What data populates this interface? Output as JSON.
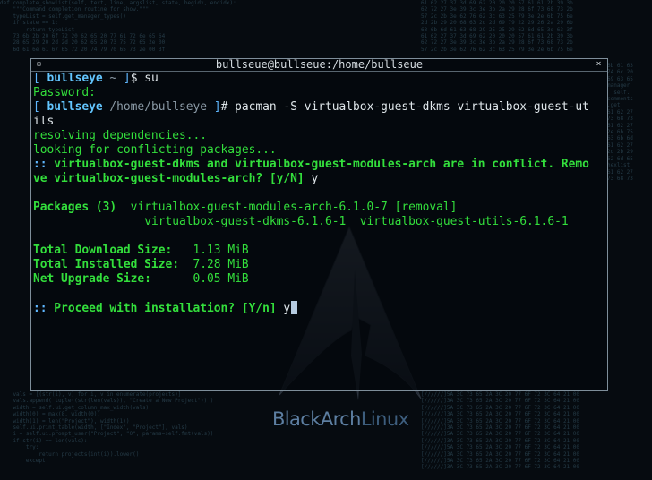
{
  "window": {
    "title": "bullseue@bullseue:/home/bullseue",
    "close_icon": "×"
  },
  "colors": {
    "terminal_green": "#33df3c",
    "prompt_bracket": "#5fb7ff",
    "prompt_user": "#63c6ff",
    "background": "#060b10"
  },
  "terminal": {
    "line1": {
      "open": "[",
      "user": "bullseye",
      "path": "~",
      "close": "]",
      "sym": "$",
      "cmd": "su"
    },
    "line2": "Password:",
    "line3": {
      "open": "[",
      "user": "bullseye",
      "path": "/home/bullseye",
      "close": "]",
      "sym": "#",
      "cmd": "pacman -S virtualbox-guest-dkms virtualbox-guest-ut"
    },
    "line4": "ils",
    "line5": "resolving dependencies...",
    "line6": "looking for conflicting packages...",
    "line7": {
      "marker": "::",
      "text": "virtualbox-guest-dkms and virtualbox-guest-modules-arch are in conflict. Remo"
    },
    "line8": {
      "text": "ve virtualbox-guest-modules-arch? [y/N]",
      "answer": "y"
    },
    "packages": {
      "label": "Packages (3)",
      "row1": "virtualbox-guest-modules-arch-6.1.0-7 [removal]",
      "row2": "virtualbox-guest-dkms-6.1.6-1  virtualbox-guest-utils-6.1.6-1"
    },
    "sizes": [
      {
        "label": "Total Download Size:",
        "value": "1.13 MiB"
      },
      {
        "label": "Total Installed Size:",
        "value": "7.28 MiB"
      },
      {
        "label": "Net Upgrade Size:",
        "value": "0.05 MiB"
      }
    ],
    "proceed": {
      "marker": "::",
      "text": "Proceed with installation? [Y/n]",
      "answer": "y"
    }
  },
  "wallpaper": {
    "brand_part1": "BlackArch",
    "brand_part2": "Linux",
    "code_tl": "def complete_showlist(self, text, line, argslist, state, begidx, endidx):\n    \"\"\"Command completion routine for show.\"\"\"\n    typeList = self.get_manager_types()\n    if state == 1:\n        return typeList\n    73 6b 2b 20 6f 72 20 62 65 20 77 61 72 6e 65 64\n    28 65 29 20 2d 2d 20 62 65 20 73 75 72 65 2e 00\n    6d 61 6e 61 67 65 72 20 74 79 70 65 73 2e 00 3f",
    "code_tr": "61 62 27 37 3d 69 62 20 20 20 57 61 61 2b 39 3b\n62 72 27 3e 39 3c 3e 3b 2a 29 28 6f 73 68 73 2b\n57 2c 2b 3e 62 76 62 3c 63 25 79 3e 2e 6b 75 6e\n2d 2b 29 20 68 63 2d 2d 69 79 22 29 26 2a 29 6b\n63 6b 6d 61 63 68 29 25 25 29 62 6d 65 3d 63 3f\n61 62 27 37 3d 69 62 20 20 20 57 61 61 2b 39 3b\n62 72 27 3e 39 3c 3e 3b 2a 29 28 6f 73 68 73 2b\n57 2c 2b 3e 62 76 62 3c 63 25 79 3e 2e 6b 75 6e",
    "code_r": "6b 61 63\n74 6c 20\n69 63 65\nmanager\n  self.\ncomments\n.get\n61 62 27\n73 68 73\n61 62 27\n2e 6b 75\n63 6b 6d\n61 62 27\n2d 2b 29\n62 6d 65\nhexlist\n61 62 27\n73 68 73",
    "code_bl": "    vals = [(str(i), v) for i, v in enumerate(projects)]\n    vals.append( tuple((str(len(vals)), \"Create a New Project\")) )\n    width = self.ui.get_column_max_width(vals)\n    width(0) = max(8, width(0))\n    width(1) = len(\"Project\"), width(1))\n    self.ui.print_table(width, [\"Index\", \"Project\"], vals)\n    i = self.ui.prompt_user(\"Project\", \"0\", params=self.fmt(vals))\n    if str(i) == len(vals):\n        try:\n            return projects(int(i)).lower()\n        except:",
    "code_br": "[//////]5A 3C 73 65 2A 3C 20 77 6F 72 3C 64 21 00\n[//////]3A 3C 73 65 2A 3C 20 77 6F 72 3C 64 21 00\n[//////]5A 3C 73 65 2A 3C 20 77 6F 72 3C 64 21 00\n[//////]3A 3C 73 65 2A 3C 20 77 6F 72 3C 64 21 00\n[//////]5A 3C 73 65 2A 3C 20 77 6F 72 3C 64 21 00\n[//////]3A 3C 73 65 2A 3C 20 77 6F 72 3C 64 21 00\n[//////]5A 3C 73 65 2A 3C 20 77 6F 72 3C 64 21 00\n[//////]3A 3C 73 65 2A 3C 20 77 6F 72 3C 64 21 00\n[//////]5A 3C 73 65 2A 3C 20 77 6F 72 3C 64 21 00\n[//////]3A 3C 73 65 2A 3C 20 77 6F 72 3C 64 21 00\n[//////]5A 3C 73 65 2A 3C 20 77 6F 72 3C 64 21 00\n[//////]3A 3C 73 65 2A 3C 20 77 6F 72 3C 64 21 00"
  }
}
